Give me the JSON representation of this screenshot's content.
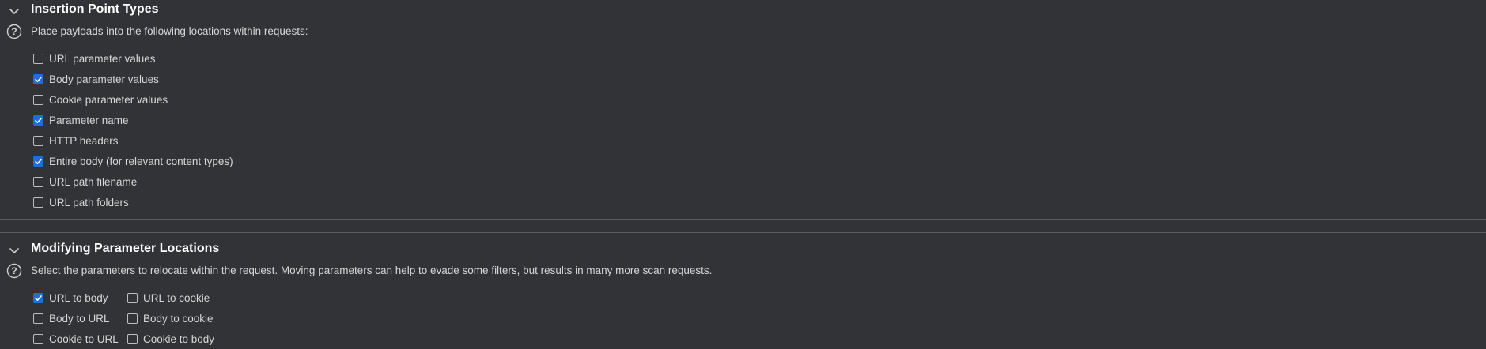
{
  "insertion_point_types": {
    "title": "Insertion Point Types",
    "description": "Place payloads into the following locations within requests:",
    "options": [
      {
        "label": "URL parameter values",
        "checked": false
      },
      {
        "label": "Body parameter values",
        "checked": true
      },
      {
        "label": "Cookie parameter values",
        "checked": false
      },
      {
        "label": "Parameter name",
        "checked": true
      },
      {
        "label": "HTTP headers",
        "checked": false
      },
      {
        "label": "Entire body (for relevant content types)",
        "checked": true
      },
      {
        "label": "URL path filename",
        "checked": false
      },
      {
        "label": "URL path folders",
        "checked": false
      }
    ]
  },
  "modifying_parameter_locations": {
    "title": "Modifying Parameter Locations",
    "description": "Select the parameters to relocate within the request. Moving parameters can help to evade some filters, but results in many more scan requests.",
    "options": [
      {
        "label": "URL to body",
        "checked": true
      },
      {
        "label": "URL to cookie",
        "checked": false
      },
      {
        "label": "Body to URL",
        "checked": false
      },
      {
        "label": "Body to cookie",
        "checked": false
      },
      {
        "label": "Cookie to URL",
        "checked": false
      },
      {
        "label": "Cookie to body",
        "checked": false
      }
    ]
  },
  "colors": {
    "background": "#323336",
    "checkbox_checked": "#1f6fd6",
    "title_text": "#ffffff",
    "body_text": "#d6d6d6"
  },
  "icons": {
    "collapse": "chevron-down-icon",
    "help": "help-circle-icon"
  }
}
